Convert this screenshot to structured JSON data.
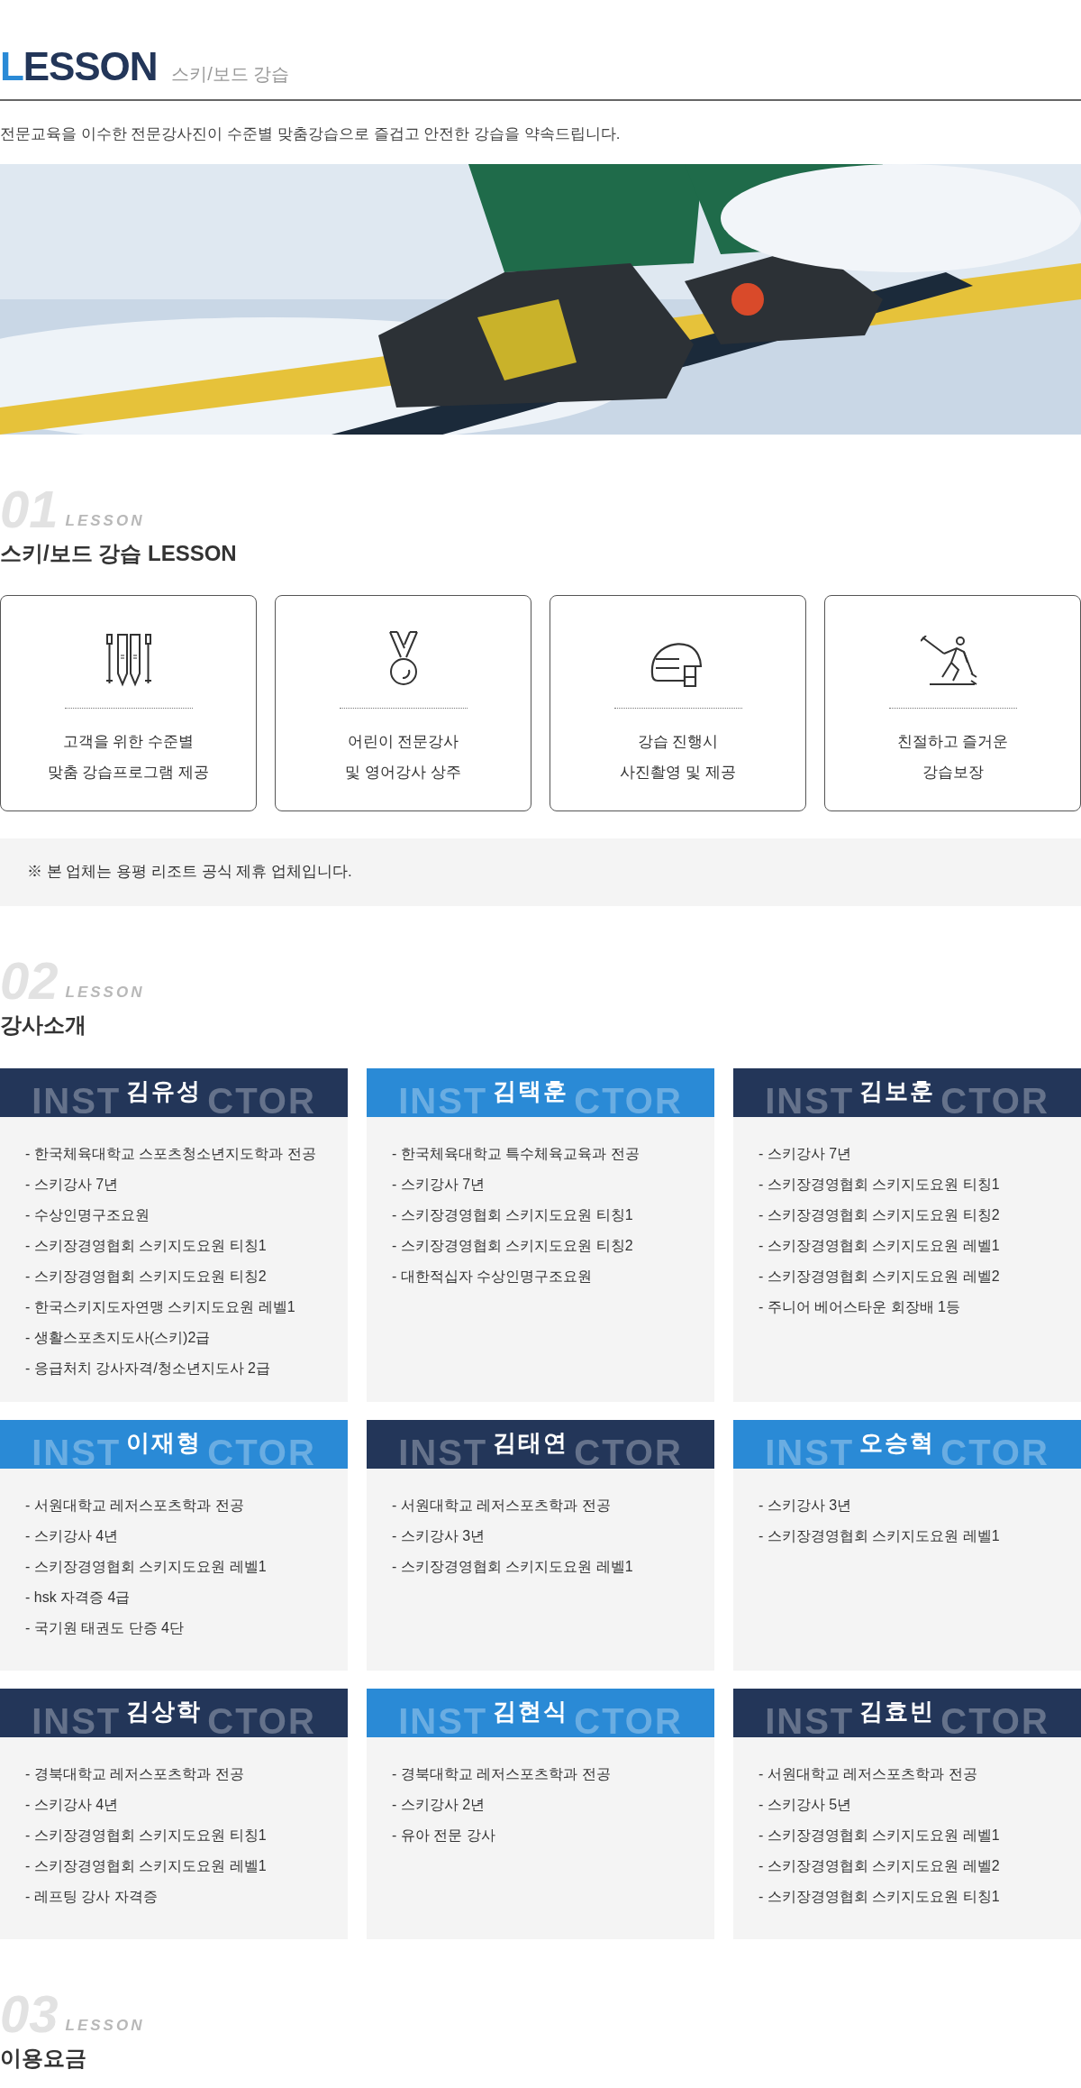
{
  "header": {
    "title_initial": "L",
    "title_rest": "ESSON",
    "subtitle": "스키/보드 강습"
  },
  "intro": "전문교육을 이수한 전문강사진이 수준별 맞춤강습으로 즐겁고 안전한 강습을 약속드립니다.",
  "section_1": {
    "number": "01",
    "label": "LESSON",
    "heading": "스키/보드 강습 LESSON",
    "features": [
      {
        "lines": [
          "고객을 위한 수준별",
          "맞춤 강습프로그램 제공"
        ]
      },
      {
        "lines": [
          "어린이 전문강사",
          "및 영어강사 상주"
        ]
      },
      {
        "lines": [
          "강습 진행시",
          "사진촬영 및 제공"
        ]
      },
      {
        "lines": [
          "친절하고 즐거운",
          "강습보장"
        ]
      }
    ],
    "notice": "※ 본 업체는 용평 리조트 공식 제휴 업체입니다."
  },
  "section_2": {
    "number": "02",
    "label": "LESSON",
    "heading": "강사소개",
    "instructors": [
      {
        "name": "김유성",
        "watermark_left": "INST",
        "watermark_right": "CTOR",
        "color": "#233659",
        "career": [
          "- 한국체육대학교 스포츠청소년지도학과 전공",
          "- 스키강사 7년",
          "- 수상인명구조요원",
          "- 스키장경영협회 스키지도요원 티칭1",
          "- 스키장경영협회 스키지도요원 티칭2",
          "- 한국스키지도자연맹 스키지도요원 레벨1",
          "- 생활스포츠지도사(스키)2급",
          "- 응급처치 강사자격/청소년지도사 2급"
        ]
      },
      {
        "name": "김택훈",
        "watermark_left": "INST",
        "watermark_right": "CTOR",
        "color": "#2a8ad6",
        "career": [
          "- 한국체육대학교 특수체육교육과 전공",
          "- 스키강사 7년",
          "- 스키장경영협회 스키지도요원 티칭1",
          "- 스키장경영협회 스키지도요원 티칭2",
          "- 대한적십자 수상인명구조요원"
        ]
      },
      {
        "name": "김보훈",
        "watermark_left": "INST",
        "watermark_right": "CTOR",
        "color": "#233659",
        "career": [
          "- 스키강사 7년",
          "- 스키장경영협회 스키지도요원 티칭1",
          "- 스키장경영협회 스키지도요원 티칭2",
          "- 스키장경영협회 스키지도요원 레벨1",
          "- 스키장경영협회 스키지도요원 레벨2",
          "- 주니어 베어스타운 회장배 1등"
        ]
      },
      {
        "name": "이재형",
        "watermark_left": "INST",
        "watermark_right": "CTOR",
        "color": "#2a8ad6",
        "career": [
          "- 서원대학교 레저스포츠학과 전공",
          "- 스키강사 4년",
          "- 스키장경영협회 스키지도요원 레벨1",
          "- hsk 자격증 4급",
          "- 국기원 태권도 단증 4단"
        ]
      },
      {
        "name": "김태연",
        "watermark_left": "INST",
        "watermark_right": "CTOR",
        "color": "#233659",
        "career": [
          "- 서원대학교 레저스포츠학과 전공",
          "- 스키강사 3년",
          "- 스키장경영협회 스키지도요원 레벨1"
        ]
      },
      {
        "name": "오승혁",
        "watermark_left": "INST",
        "watermark_right": "CTOR",
        "color": "#2a8ad6",
        "career": [
          "- 스키강사 3년",
          "- 스키장경영협회 스키지도요원 레벨1"
        ]
      },
      {
        "name": "김상학",
        "watermark_left": "INST",
        "watermark_right": "CTOR",
        "color": "#233659",
        "career": [
          "- 경북대학교 레저스포츠학과 전공",
          "- 스키강사 4년",
          "- 스키장경영협회 스키지도요원 티칭1",
          "- 스키장경영협회 스키지도요원 레벨1",
          "- 레프팅 강사 자격증"
        ]
      },
      {
        "name": "김현식",
        "watermark_left": "INST",
        "watermark_right": "CTOR",
        "color": "#2a8ad6",
        "career": [
          "- 경북대학교 레저스포츠학과 전공",
          "- 스키강사 2년",
          "- 유아 전문 강사"
        ]
      },
      {
        "name": "김효빈",
        "watermark_left": "INST",
        "watermark_right": "CTOR",
        "color": "#233659",
        "career": [
          "- 서원대학교 레저스포츠학과 전공",
          "- 스키강사 5년",
          "- 스키장경영협회 스키지도요원 레벨1",
          "- 스키장경영협회 스키지도요원 레벨2",
          "- 스키장경영협회 스키지도요원 티칭1"
        ]
      }
    ]
  },
  "section_3": {
    "number": "03",
    "label": "LESSON",
    "heading": "이용요금"
  }
}
